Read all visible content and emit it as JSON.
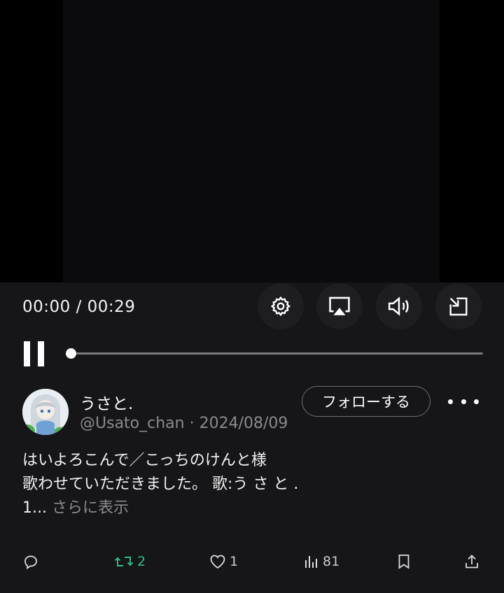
{
  "player": {
    "time_display": "00:00 / 00:29",
    "progress_fraction": 0.0
  },
  "controls": {
    "settings_icon": "gear-icon",
    "airplay_icon": "airplay-icon",
    "volume_icon": "volume-icon",
    "exit_fullscreen_icon": "minimize-arrow-icon",
    "pause_icon": "pause-icon"
  },
  "post": {
    "display_name": "うさと.",
    "handle_date": "@Usato_chan · 2024/08/09",
    "follow_label": "フォローする",
    "text_lines": [
      "はいよろこんで／こっちのけんと様",
      "歌わせていただきました。 歌:う さ と .",
      "1..."
    ],
    "show_more": "さらに表示"
  },
  "actions": {
    "reply_count": "",
    "repost_count": "2",
    "like_count": "1",
    "views_count": "81"
  },
  "colors": {
    "panel_bg": "#161518",
    "repost_green": "#2fbf83",
    "muted_text": "#8b8a8e"
  }
}
